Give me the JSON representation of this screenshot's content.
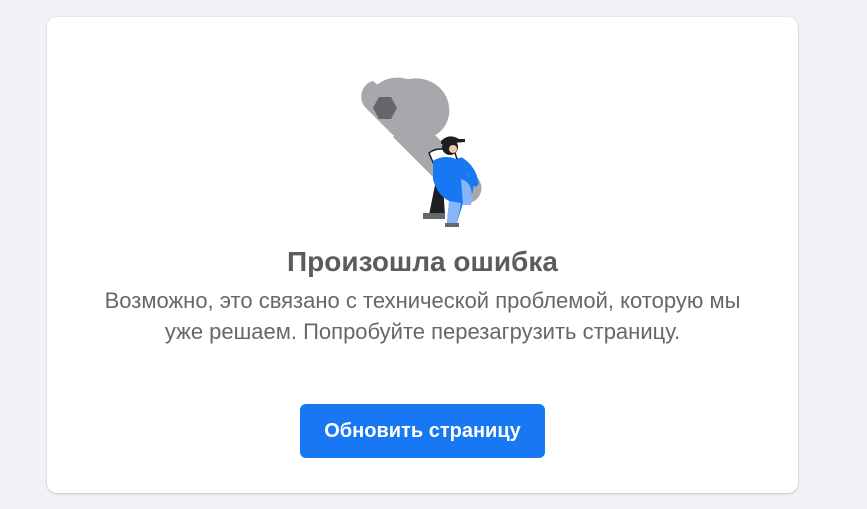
{
  "error": {
    "title": "Произошла ошибка",
    "message": "Возможно, это связано с технической проблемой, которую мы уже решаем. Попробуйте перезагрузить страницу.",
    "reload_button_label": "Обновить страницу",
    "illustration_icon": "wrench-worker-icon"
  },
  "colors": {
    "page_background": "#f0f2f5",
    "card_background": "#ffffff",
    "accent": "#1877f2",
    "title_text": "#5a5c60",
    "body_text": "#65676b"
  }
}
